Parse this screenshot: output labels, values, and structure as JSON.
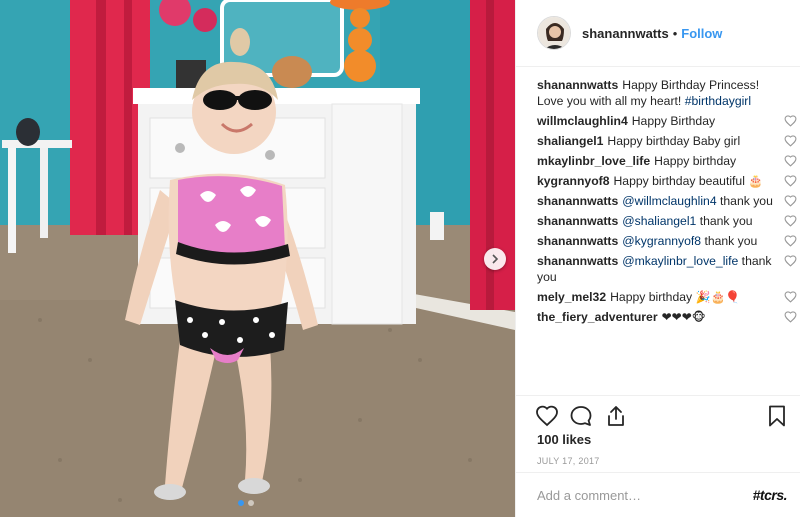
{
  "post": {
    "photo_alt": "Toddler in pink heart bikini and sunglasses",
    "carousel_dots": 2,
    "carousel_active_index": 0
  },
  "header": {
    "username": "shanannwatts",
    "separator": "•",
    "follow_label": "Follow"
  },
  "caption": {
    "username": "shanannwatts",
    "text": "Happy Birthday Princess! Love you with all my heart! ",
    "hashtag": "#birthdaygirl"
  },
  "comments": [
    {
      "username": "willmclaughlin4",
      "mention": "",
      "text": "Happy Birthday",
      "emoji": ""
    },
    {
      "username": "shaliangel1",
      "mention": "",
      "text": "Happy birthday Baby girl",
      "emoji": ""
    },
    {
      "username": "mkaylinbr_love_life",
      "mention": "",
      "text": "Happy birthday",
      "emoji": ""
    },
    {
      "username": "kygrannyof8",
      "mention": "",
      "text": "Happy birthday beautiful ",
      "emoji": "🎂"
    },
    {
      "username": "shanannwatts",
      "mention": "@willmclaughlin4",
      "text": " thank you",
      "emoji": ""
    },
    {
      "username": "shanannwatts",
      "mention": "@shaliangel1",
      "text": " thank you",
      "emoji": ""
    },
    {
      "username": "shanannwatts",
      "mention": "@kygrannyof8",
      "text": " thank you",
      "emoji": ""
    },
    {
      "username": "shanannwatts",
      "mention": "@mkaylinbr_love_life",
      "text": " thank you",
      "emoji": ""
    },
    {
      "username": "mely_mel32",
      "mention": "",
      "text": "Happy birthday ",
      "emoji": "🎉🎂🎈"
    },
    {
      "username": "the_fiery_adventurer",
      "mention": "",
      "text": "",
      "emoji": "❤❤❤🐵"
    }
  ],
  "actions": {
    "like_icon": "heart-outline-icon",
    "comment_icon": "speech-bubble-icon",
    "share_icon": "share-icon",
    "save_icon": "bookmark-icon"
  },
  "likes": "100 likes",
  "date": "JULY 17, 2017",
  "add_comment": {
    "placeholder": "Add a comment…",
    "watermark": "#tcrs."
  },
  "colors": {
    "accent": "#3897f0",
    "mention": "#003569",
    "muted": "#999999",
    "border": "#efefef"
  }
}
